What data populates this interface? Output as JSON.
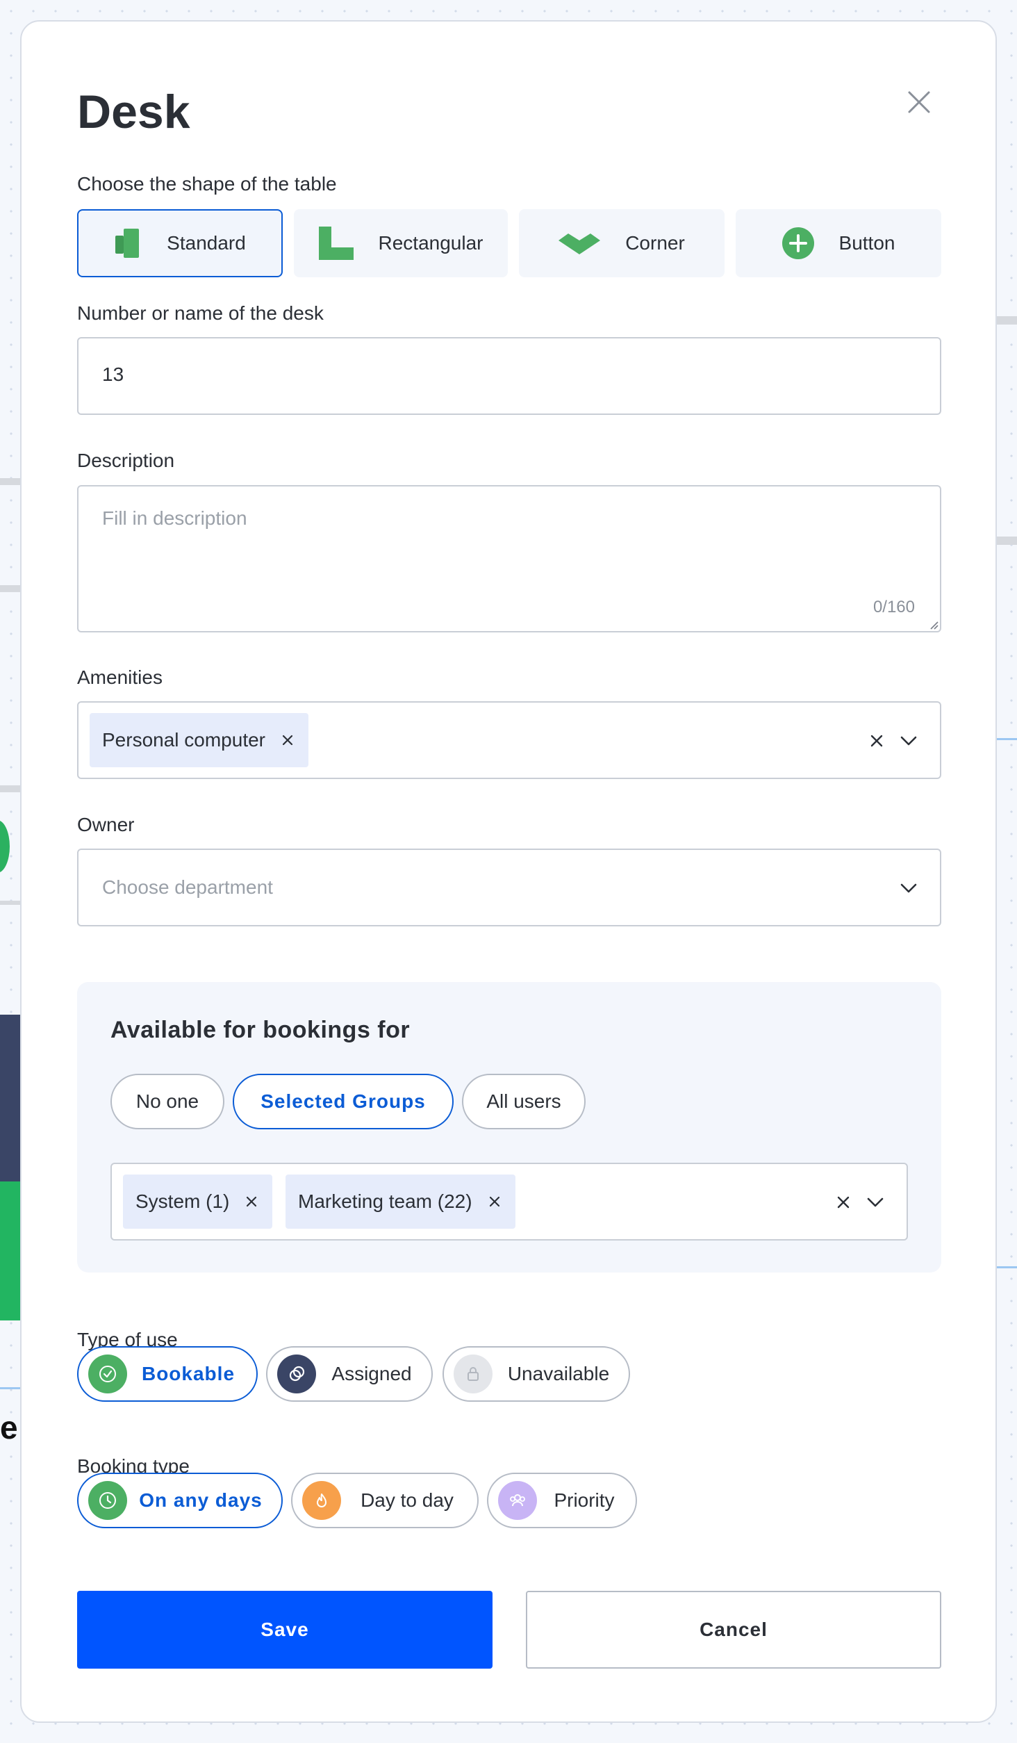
{
  "modal": {
    "title": "Desk",
    "shape_label": "Choose the shape of the table",
    "shapes": [
      {
        "label": "Standard",
        "icon": "standard-desk-icon",
        "selected": true
      },
      {
        "label": "Rectangular",
        "icon": "rectangular-desk-icon",
        "selected": false
      },
      {
        "label": "Corner",
        "icon": "corner-desk-icon",
        "selected": false
      },
      {
        "label": "Button",
        "icon": "plus-circle-icon",
        "selected": false
      }
    ],
    "name_label": "Number or name of the desk",
    "name_value": "13",
    "description_label": "Description",
    "description_placeholder": "Fill in description",
    "description_counter": "0/160",
    "amenities_label": "Amenities",
    "amenities": [
      "Personal computer"
    ],
    "owner_label": "Owner",
    "owner_placeholder": "Choose department",
    "availability": {
      "title": "Available for bookings for",
      "options": [
        "No one",
        "Selected Groups",
        "All users"
      ],
      "selected": "Selected Groups",
      "groups": [
        "System (1)",
        "Marketing team (22)"
      ]
    },
    "type_of_use": {
      "label": "Type of use",
      "options": [
        "Bookable",
        "Assigned",
        "Unavailable"
      ],
      "selected": "Bookable"
    },
    "booking_type": {
      "label": "Booking type",
      "options": [
        "On any days",
        "Day to day",
        "Priority"
      ],
      "selected": "On any days"
    },
    "save_label": "Save",
    "cancel_label": "Cancel"
  },
  "background": {
    "fragment_text": "e"
  },
  "colors": {
    "accent": "#0055ff",
    "selected_border": "#0b5cd5",
    "green": "#4caf63",
    "navy": "#3a4566",
    "orange": "#f7a04b",
    "purple": "#c8b4f5",
    "chip_bg": "#e6ecfb"
  }
}
